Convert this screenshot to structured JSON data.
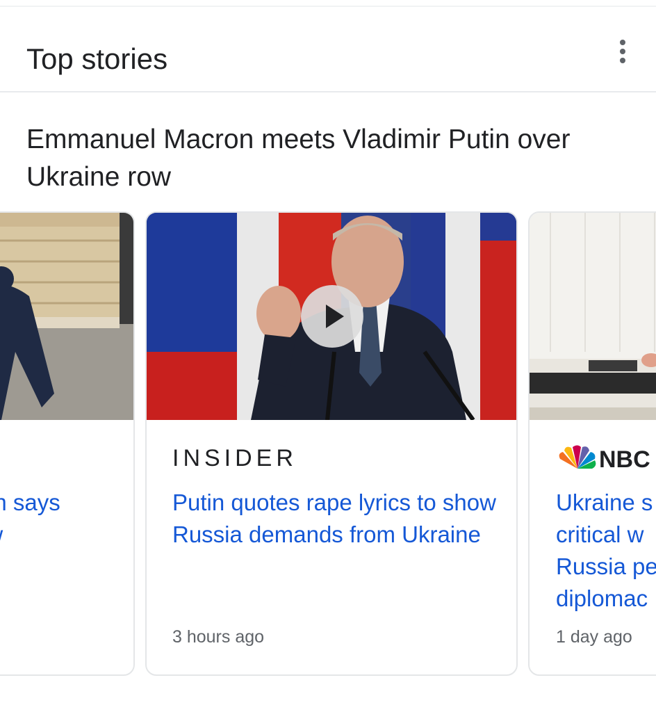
{
  "header": {
    "title": "Top stories",
    "menu_icon": "more-vert-icon"
  },
  "story": {
    "heading": "Emmanuel Macron meets Vladimir Putin over Ukraine row"
  },
  "cards": [
    {
      "source": "",
      "headline_line1": "ron says",
      "headline_line2": "ew",
      "time": ""
    },
    {
      "source": "INSIDER",
      "headline": "Putin quotes rape lyrics to show Russia demands from Ukraine",
      "time": "3 hours ago",
      "has_video": true
    },
    {
      "source": "NBC",
      "headline": "Ukraine s critical w Russia pe diplomac",
      "headline_lines": [
        "Ukraine s",
        "critical w",
        "Russia pe",
        "diplomac"
      ],
      "time": "1 day ago"
    }
  ],
  "colors": {
    "link": "#1558d6",
    "text": "#202124",
    "meta": "#5f6368"
  }
}
